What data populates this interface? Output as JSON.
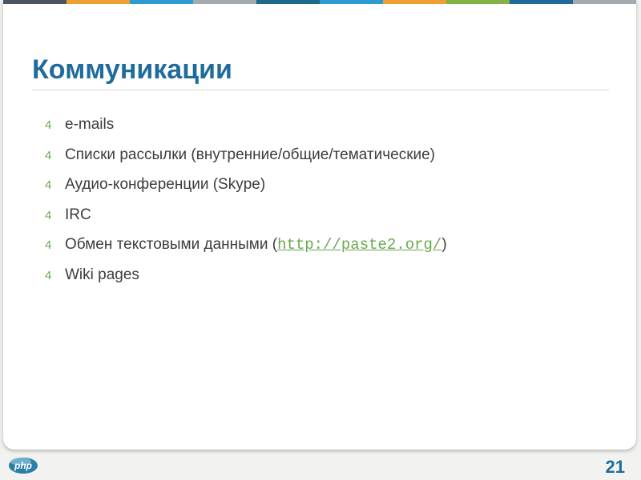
{
  "colors": {
    "stripe": [
      "#4b5564",
      "#f0a033",
      "#2b9bd1",
      "#a3abae",
      "#1e6a8a",
      "#2b9bd1",
      "#f0a033",
      "#83b443",
      "#1d6a9b",
      "#a3abae"
    ],
    "title": "#1f6c9c",
    "bullet": "#6aa84f"
  },
  "title": "Коммуникации",
  "bullet_glyph": "4",
  "items": [
    {
      "text": "e-mails"
    },
    {
      "text": "Списки рассылки (внутренние/общие/тематические)"
    },
    {
      "text": "Аудио-конференции (Skype)"
    },
    {
      "text": "IRC"
    },
    {
      "pre": "Обмен текстовыми данными (",
      "link": "http://paste2.org/",
      "post": ")"
    },
    {
      "text": "Wiki pages"
    }
  ],
  "logo_text": "php",
  "page_number": "21"
}
